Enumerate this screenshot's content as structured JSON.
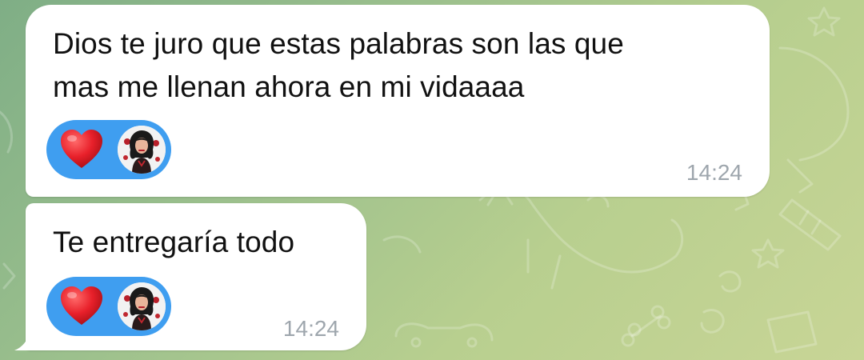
{
  "chat": {
    "messages": [
      {
        "text": "Dios te juro que estas palabras son las que\nmas me llenan ahora en mi vidaaaa",
        "time": "14:24",
        "reaction": {
          "emoji": "heart-icon",
          "count_avatars": 1
        }
      },
      {
        "text": "Te entregaría todo",
        "time": "14:24",
        "reaction": {
          "emoji": "heart-icon",
          "count_avatars": 1
        }
      }
    ]
  },
  "colors": {
    "bubble": "#ffffff",
    "reaction_pill": "#3f9ef0",
    "heart": "#e8202a",
    "time_text": "#9ea6ad",
    "wallpaper_start": "#7fae86",
    "wallpaper_end": "#c8d596"
  }
}
